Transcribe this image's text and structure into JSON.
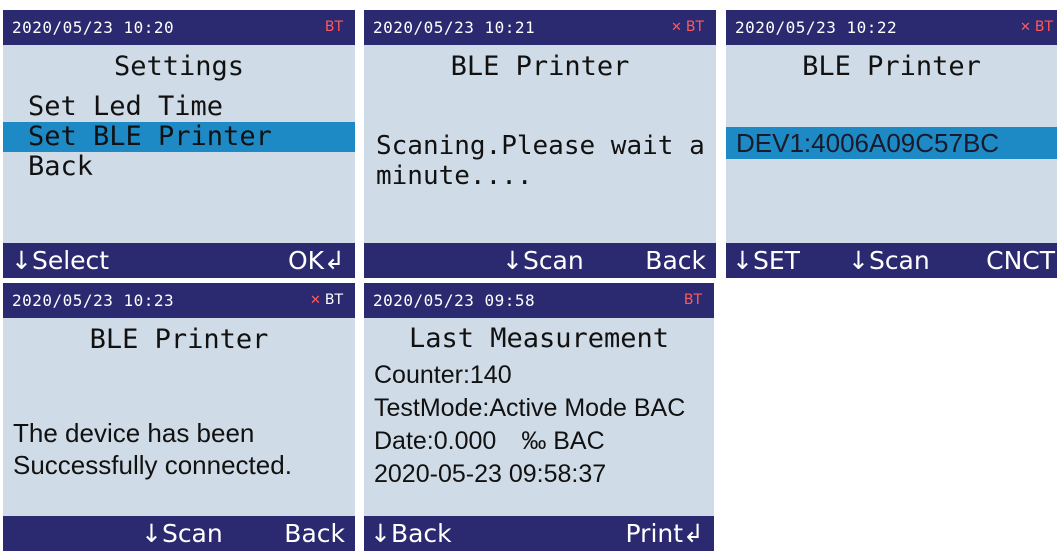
{
  "screens": [
    {
      "time": "2020/05/23 10:20",
      "bt": "BT",
      "title": "Settings",
      "items": [
        "Set Led Time",
        "Set BLE Printer",
        "Back"
      ],
      "soft_left": "↓Select",
      "soft_right": "OK↲"
    },
    {
      "time": "2020/05/23 10:21",
      "bt": "BT",
      "title": "BLE Printer",
      "message_1": "Scaning.Please wait a",
      "message_2": "minute....",
      "soft_mid": "↓Scan",
      "soft_right": "Back"
    },
    {
      "time": "2020/05/23 10:22",
      "bt": "BT",
      "title": "BLE Printer",
      "device": "DEV1:4006A09C57BC",
      "soft_left": "↓SET",
      "soft_mid": "↓Scan",
      "soft_right": "CNCT"
    },
    {
      "time": "2020/05/23 10:23",
      "bt": "BT",
      "title": "BLE Printer",
      "message_1": "The device has been",
      "message_2": "Successfully connected.",
      "soft_mid": "↓Scan",
      "soft_right": "Back"
    },
    {
      "time": "2020/05/23 09:58",
      "bt": "BT",
      "title": "Last Measurement",
      "counter": "Counter:140",
      "testmode": "TestMode:Active Mode BAC",
      "date": "Date:0.000　‰ BAC",
      "datetime": "2020-05-23 09:58:37",
      "soft_left": "↓Back",
      "soft_right": "Print↲"
    }
  ],
  "colors": {
    "bar": "#2b2a70",
    "screen_bg": "#cfdbe6",
    "highlight": "#1d8ac5",
    "bt_red": "#ff5a5a"
  }
}
